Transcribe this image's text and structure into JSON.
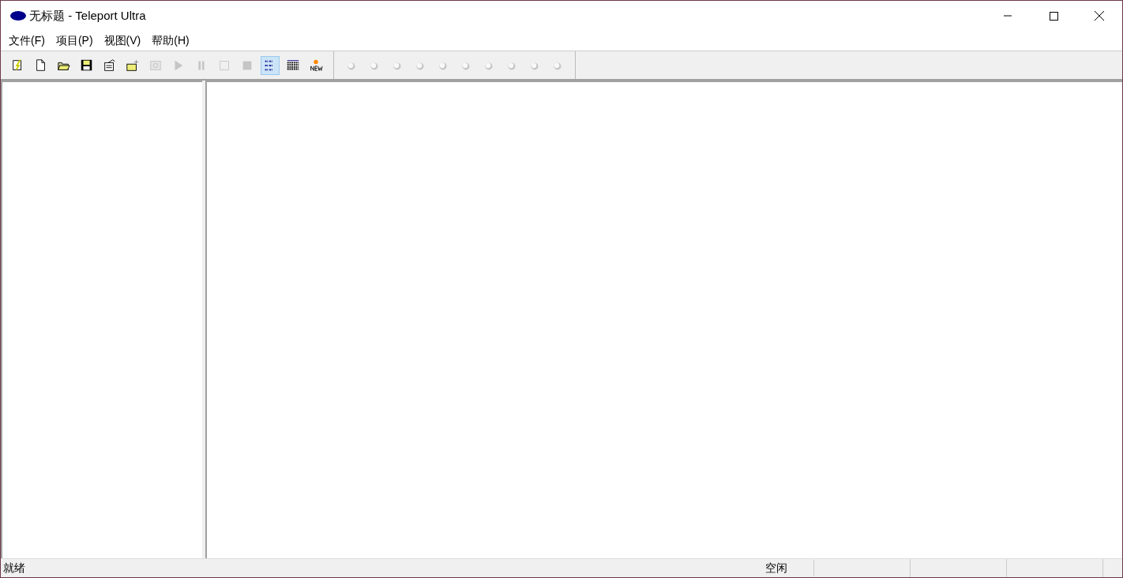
{
  "window": {
    "title": "无标题 - Teleport Ultra"
  },
  "menu": [
    {
      "label": "文件(F)"
    },
    {
      "label": "项目(P)"
    },
    {
      "label": "视图(V)"
    },
    {
      "label": "帮助(H)"
    }
  ],
  "toolbar": {
    "groups": [
      [
        {
          "selected": false,
          "disabled": false
        },
        {
          "selected": false,
          "disabled": false
        },
        {
          "selected": false,
          "disabled": false
        },
        {
          "selected": false,
          "disabled": false
        },
        {
          "selected": false,
          "disabled": false
        },
        {
          "selected": false,
          "disabled": false
        },
        {
          "selected": false,
          "disabled": true
        },
        {
          "selected": false,
          "disabled": true
        },
        {
          "selected": false,
          "disabled": true
        },
        {
          "selected": false,
          "disabled": true
        },
        {
          "selected": false,
          "disabled": true
        },
        {
          "selected": true,
          "disabled": false
        },
        {
          "selected": false,
          "disabled": false
        },
        {
          "selected": false,
          "disabled": false
        }
      ],
      [
        {
          "selected": false,
          "disabled": true
        },
        {
          "selected": false,
          "disabled": true
        },
        {
          "selected": false,
          "disabled": true
        },
        {
          "selected": false,
          "disabled": true
        },
        {
          "selected": false,
          "disabled": true
        },
        {
          "selected": false,
          "disabled": true
        },
        {
          "selected": false,
          "disabled": true
        },
        {
          "selected": false,
          "disabled": true
        },
        {
          "selected": false,
          "disabled": true
        },
        {
          "selected": false,
          "disabled": true
        }
      ]
    ]
  },
  "status_bar": {
    "panes": [
      "就绪",
      "空闲"
    ]
  }
}
